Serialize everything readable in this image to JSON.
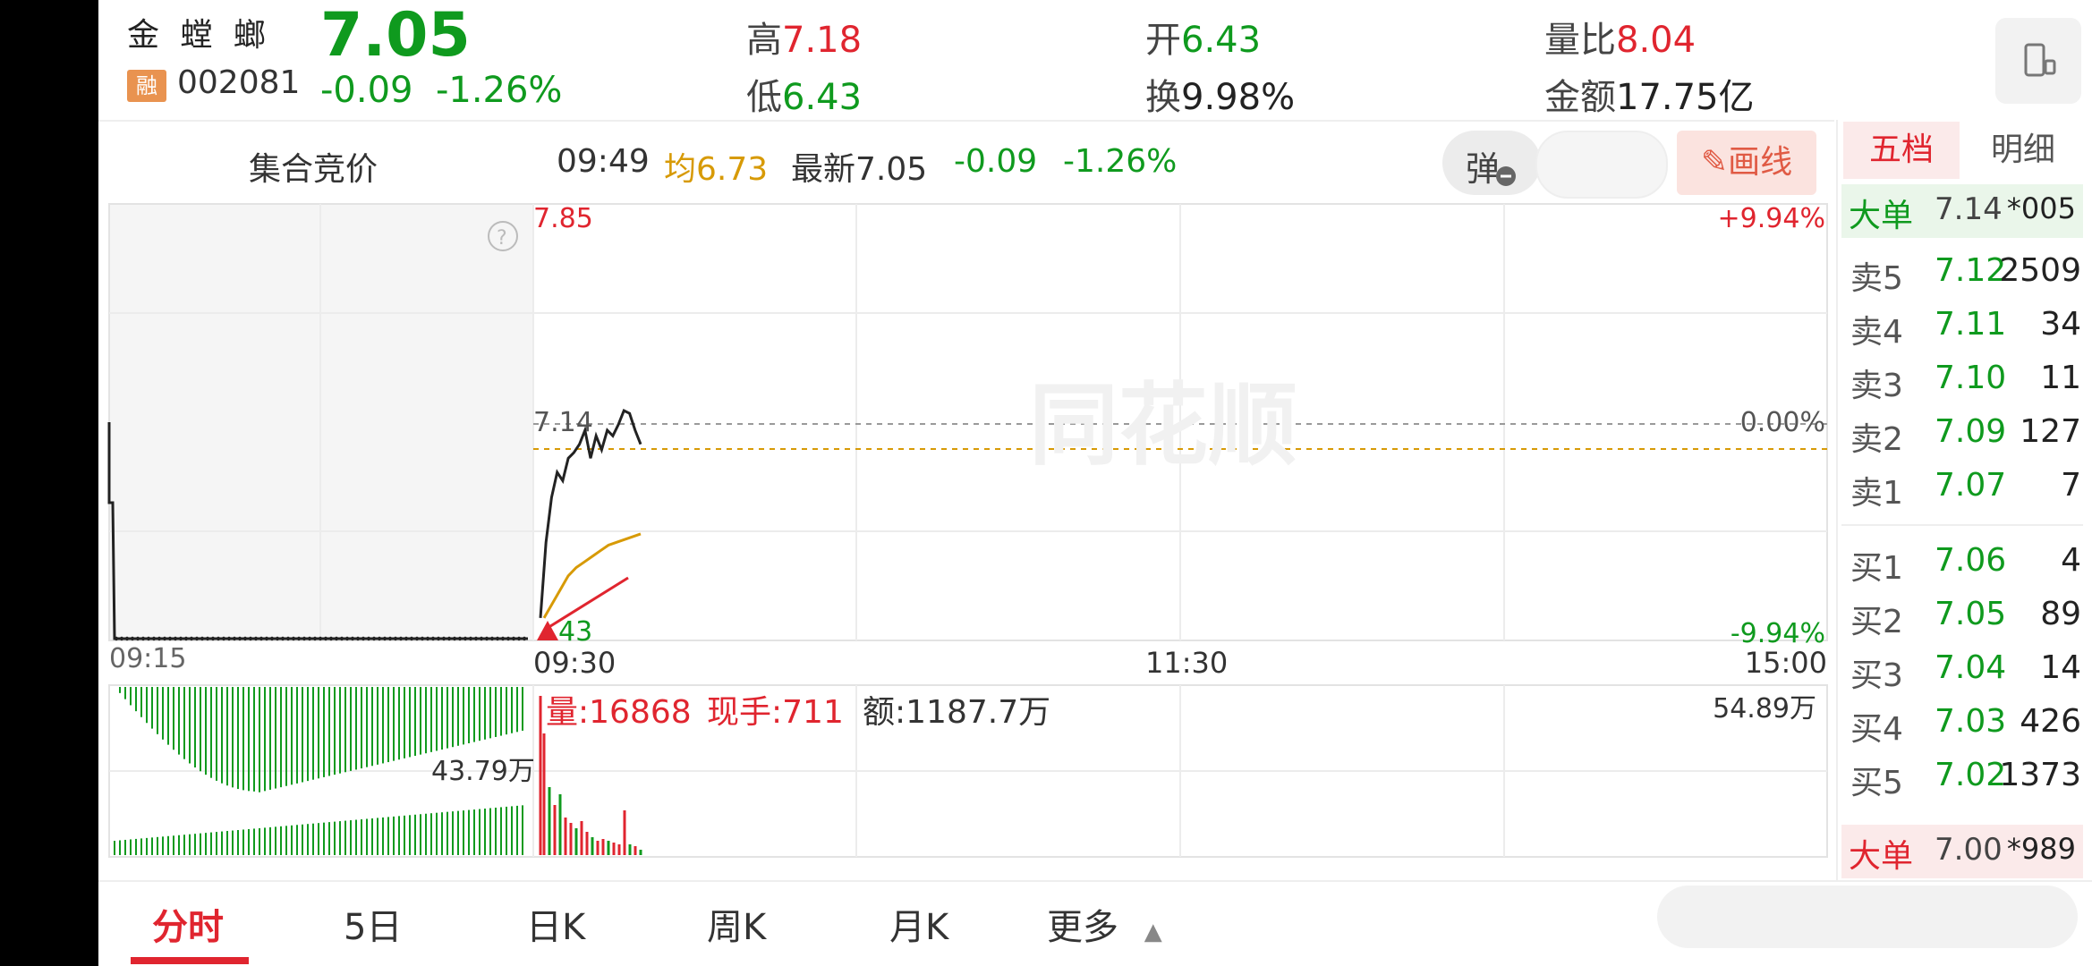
{
  "stock": {
    "name": "金 螳 螂",
    "margin_badge": "融",
    "code": "002081",
    "price": "7.05",
    "change": "-0.09",
    "change_pct": "-1.26%"
  },
  "stats": {
    "high_label": "高",
    "high": "7.18",
    "low_label": "低",
    "low": "6.43",
    "open_label": "开",
    "open": "6.43",
    "turnover_label": "换",
    "turnover": "9.98%",
    "volume_ratio_label": "量比",
    "volume_ratio": "8.04",
    "amount_label": "金额",
    "amount": "17.75亿"
  },
  "info_bar": {
    "auction_label": "集合竞价",
    "time": "09:49",
    "avg_label": "均6.73",
    "latest_label": "最新7.05",
    "change": "-0.09",
    "change_pct": "-1.26%",
    "danmu_label": "弹",
    "draw_line_label": "画线"
  },
  "chart": {
    "price_top": "7.85",
    "price_mid": "7.14",
    "price_bottom": "43",
    "pct_top": "+9.94%",
    "pct_mid": "0.00%",
    "pct_bottom": "-9.94%",
    "time_labels": [
      "09:15",
      "09:30",
      "11:30",
      "15:00"
    ],
    "auction_volume_label": "43.79万",
    "volume_label": "量:16868",
    "current_hand_label": "现手:711",
    "amount_label": "额:1187.7万",
    "max_volume_label": "54.89万",
    "watermark": "同花顺",
    "colors": {
      "price_line": "#222222",
      "avg_line": "#d79a06",
      "down_bar": "#0f9a1e",
      "up_bar": "#e0252f"
    }
  },
  "chart_data": {
    "type": "line",
    "title": "",
    "ylim": [
      6.35,
      7.85
    ],
    "reference_price": 7.14,
    "series": [
      {
        "values": [
          6.43,
          6.7,
          6.86,
          6.95,
          6.92,
          7.0,
          7.02,
          7.05,
          7.1,
          7.0,
          7.08,
          7.03,
          7.1,
          7.08,
          7.12,
          7.17,
          7.16,
          7.1,
          7.05
        ]
      },
      {
        "values": [
          6.43,
          6.48,
          6.53,
          6.58,
          6.61,
          6.63,
          6.65,
          6.67,
          6.69,
          6.7,
          6.71,
          6.72,
          6.73
        ]
      }
    ]
  },
  "order_book": {
    "tabs": [
      "五档",
      "明细"
    ],
    "big_order_top": {
      "label": "大单",
      "price": "7.14",
      "vol": "*005"
    },
    "asks": [
      {
        "label": "卖5",
        "price": "7.12",
        "vol": "2509"
      },
      {
        "label": "卖4",
        "price": "7.11",
        "vol": "34"
      },
      {
        "label": "卖3",
        "price": "7.10",
        "vol": "11"
      },
      {
        "label": "卖2",
        "price": "7.09",
        "vol": "127"
      },
      {
        "label": "卖1",
        "price": "7.07",
        "vol": "7"
      }
    ],
    "bids": [
      {
        "label": "买1",
        "price": "7.06",
        "vol": "4"
      },
      {
        "label": "买2",
        "price": "7.05",
        "vol": "89"
      },
      {
        "label": "买3",
        "price": "7.04",
        "vol": "14"
      },
      {
        "label": "买4",
        "price": "7.03",
        "vol": "426"
      },
      {
        "label": "买5",
        "price": "7.02",
        "vol": "1373"
      }
    ],
    "big_order_bottom": {
      "label": "大单",
      "price": "7.00",
      "vol": "*989"
    }
  },
  "bottom_tabs": {
    "items": [
      "分时",
      "5日",
      "日K",
      "周K",
      "月K",
      "更多"
    ],
    "active": "分时"
  }
}
